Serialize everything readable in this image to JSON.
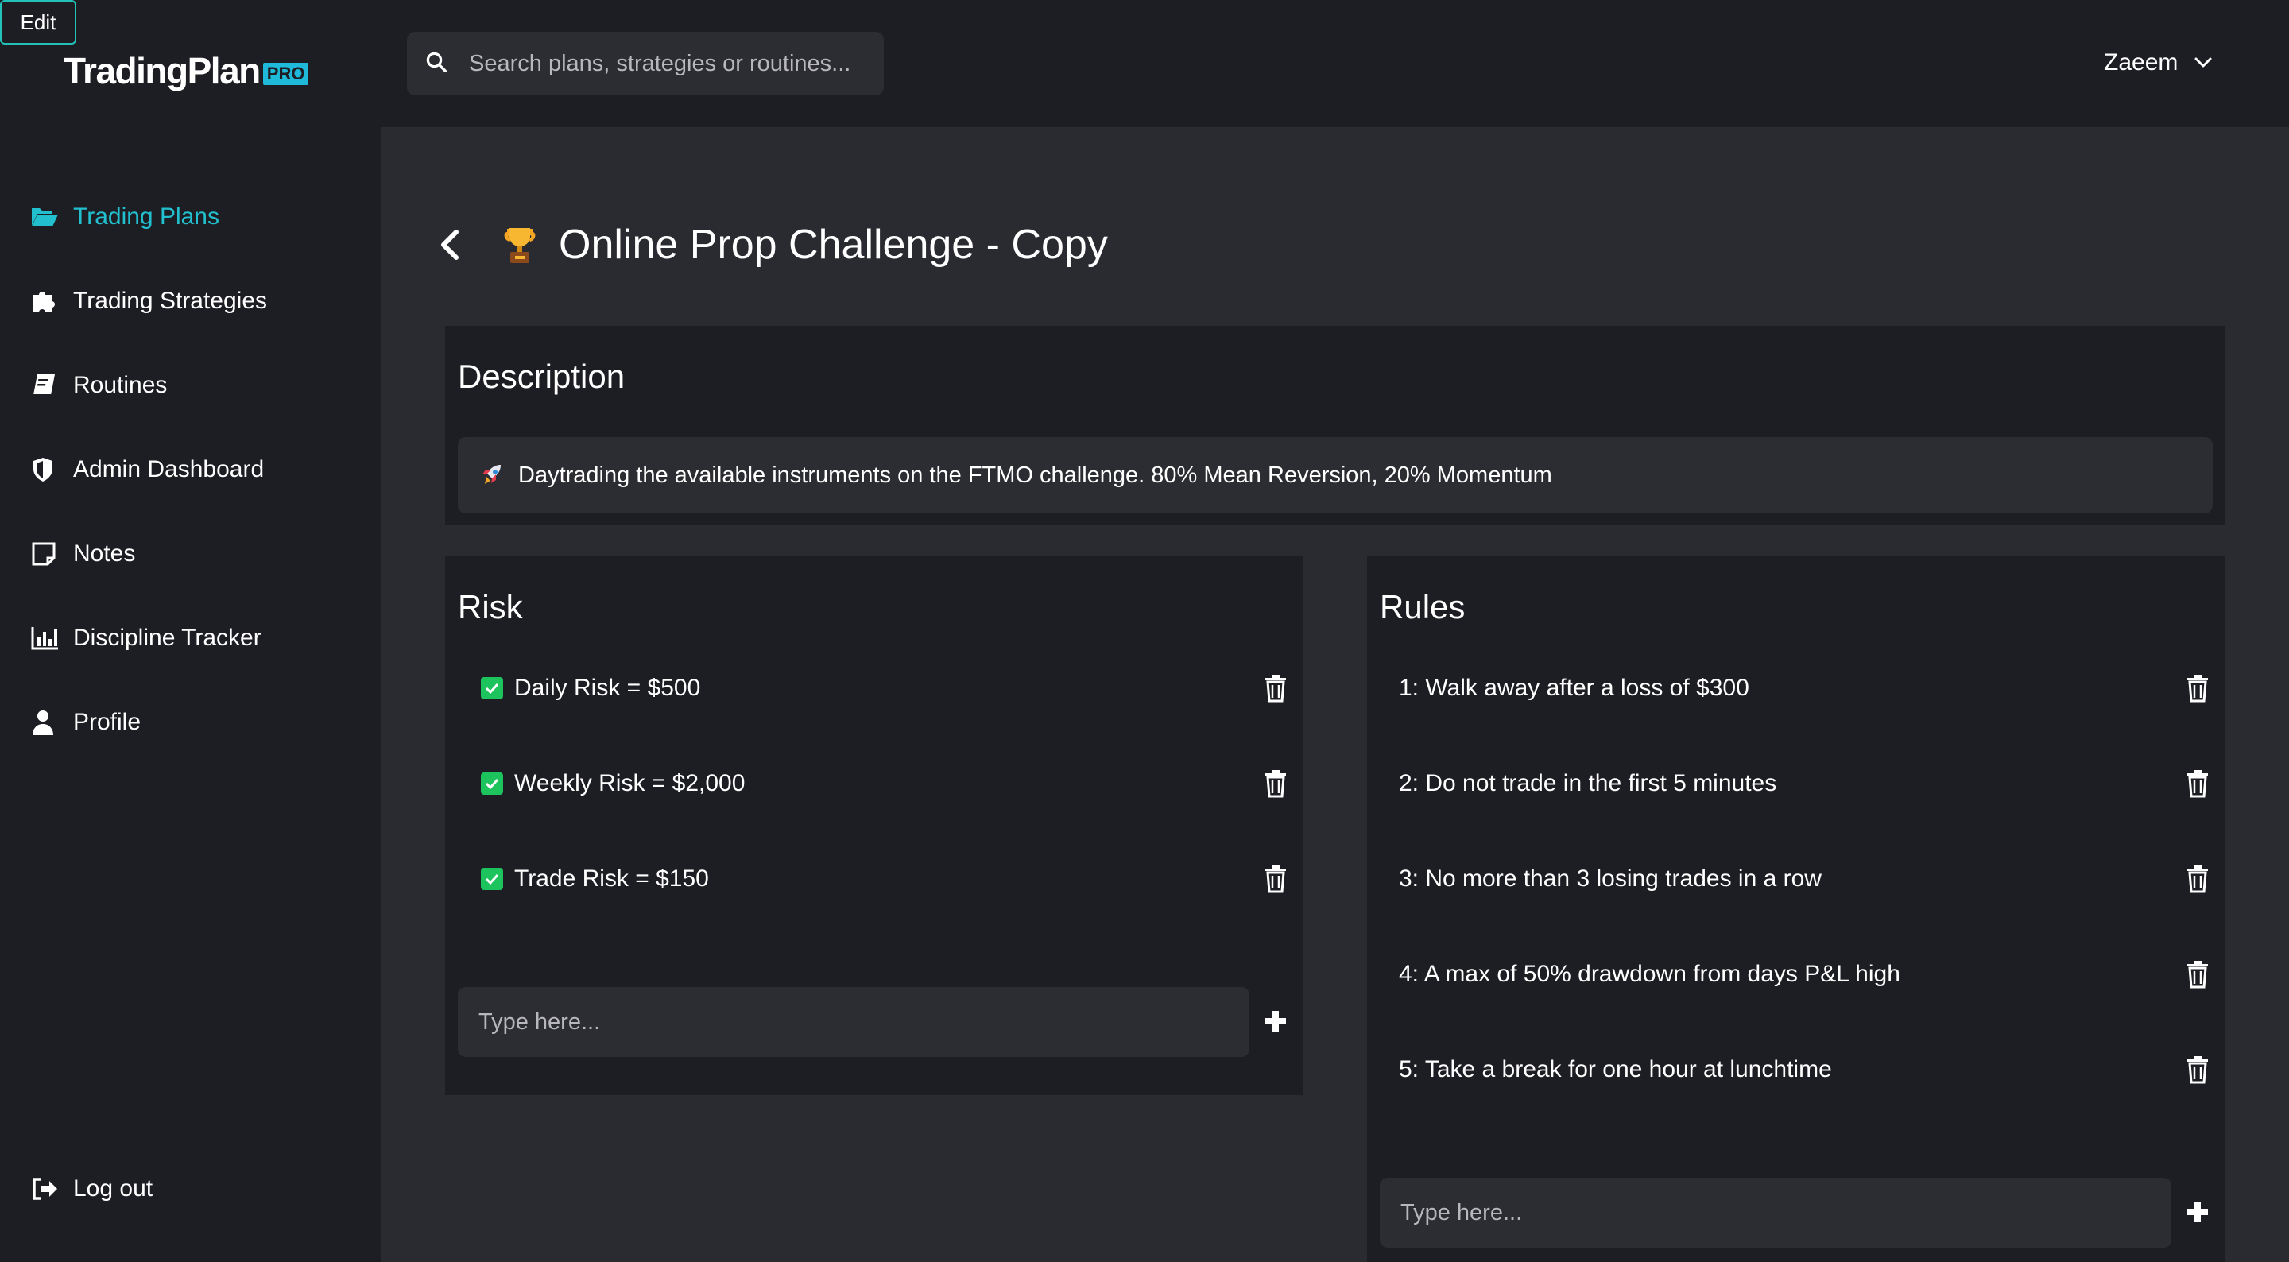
{
  "edit_label": "Edit",
  "brand": {
    "logo_text_a": "TradingPl",
    "logo_text_b": "an",
    "logo_badge": "PRO"
  },
  "search": {
    "placeholder": "Search plans, strategies or routines...",
    "value": ""
  },
  "user": {
    "name": "Zaeem"
  },
  "sidebar": {
    "items": [
      {
        "label": "Trading Plans",
        "icon": "folder-open-icon",
        "active": true
      },
      {
        "label": "Trading Strategies",
        "icon": "puzzle-icon"
      },
      {
        "label": "Routines",
        "icon": "book-icon"
      },
      {
        "label": "Admin Dashboard",
        "icon": "shield-icon"
      },
      {
        "label": "Notes",
        "icon": "note-icon"
      },
      {
        "label": "Discipline Tracker",
        "icon": "bar-chart-icon"
      },
      {
        "label": "Profile",
        "icon": "user-icon"
      }
    ],
    "logout": {
      "label": "Log out",
      "icon": "logout-icon"
    }
  },
  "page": {
    "title": "Online Prop Challenge - Copy"
  },
  "description": {
    "heading": "Description",
    "text": "Daytrading the available instruments on the FTMO challenge. 80% Mean Reversion, 20% Momentum"
  },
  "risk": {
    "heading": "Risk",
    "items": [
      {
        "label": "Daily Risk = $500",
        "checked": true
      },
      {
        "label": "Weekly Risk = $2,000",
        "checked": true
      },
      {
        "label": "Trade Risk = $150",
        "checked": true
      }
    ],
    "input_placeholder": "Type here..."
  },
  "rules": {
    "heading": "Rules",
    "items": [
      {
        "label": "1: Walk away after a loss of $300"
      },
      {
        "label": "2: Do not trade in the first 5 minutes"
      },
      {
        "label": "3: No more than 3 losing trades in a row"
      },
      {
        "label": "4: A max of 50% drawdown from days P&L high"
      },
      {
        "label": "5: Take a break for one hour at lunchtime"
      }
    ],
    "input_placeholder": "Type here..."
  },
  "colors": {
    "accent": "#22c0cf",
    "check": "#1dc35d",
    "bg": "#1d1d24",
    "content_bg": "#2a2a31",
    "field_bg": "#2c2c33"
  }
}
